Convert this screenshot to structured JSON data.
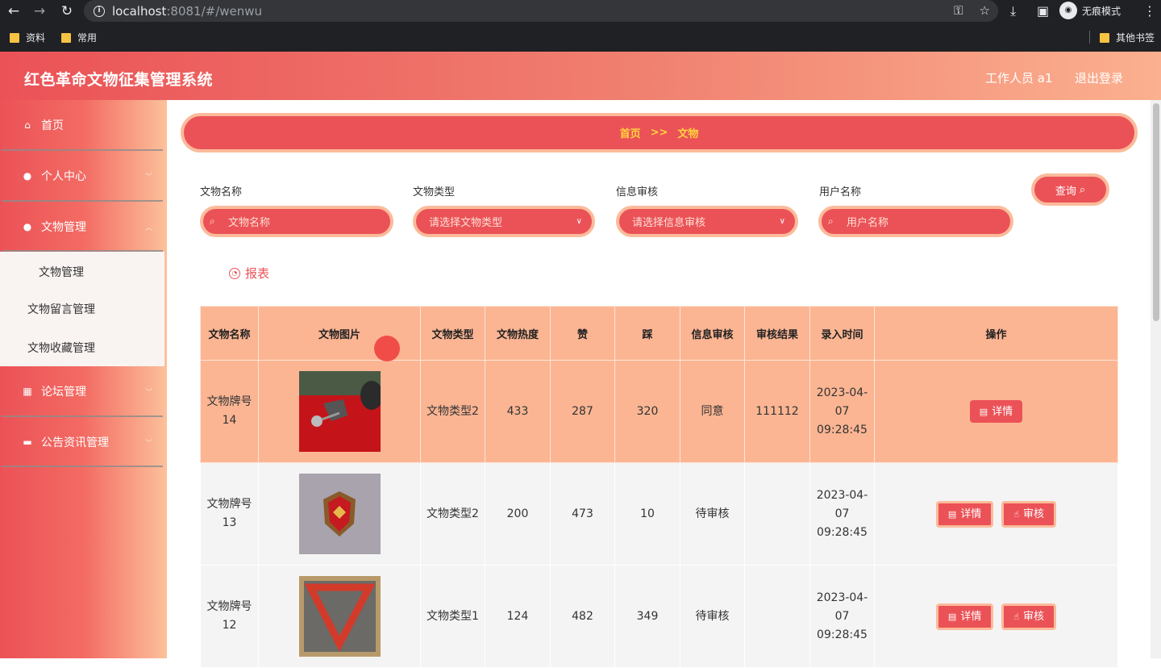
{
  "browser": {
    "url_host": "localhost",
    "url_rest": ":8081/#/wenwu",
    "incognito_label": "无痕模式",
    "bookmarks": [
      "资料",
      "常用"
    ],
    "other_bookmarks": "其他书签"
  },
  "header": {
    "title": "红色革命文物征集管理系统",
    "user": "工作人员 a1",
    "logout": "退出登录"
  },
  "sidebar": {
    "items": [
      {
        "label": "首页",
        "icon": "home-icon"
      },
      {
        "label": "个人中心",
        "icon": "user-icon"
      },
      {
        "label": "文物管理",
        "icon": "user-icon"
      },
      {
        "label": "论坛管理",
        "icon": "grid-icon"
      },
      {
        "label": "公告资讯管理",
        "icon": "briefcase-icon"
      }
    ],
    "submenu": [
      "文物管理",
      "文物留言管理",
      "文物收藏管理"
    ]
  },
  "breadcrumb": {
    "home": "首页",
    "sep": ">>",
    "current": "文物"
  },
  "filters": {
    "name_label": "文物名称",
    "name_placeholder": "文物名称",
    "type_label": "文物类型",
    "type_placeholder": "请选择文物类型",
    "audit_label": "信息审核",
    "audit_placeholder": "请选择信息审核",
    "user_label": "用户名称",
    "user_placeholder": "用户名称",
    "query": "查询"
  },
  "report": "报表",
  "table": {
    "headers": [
      "文物名称",
      "文物图片",
      "文物类型",
      "文物热度",
      "赞",
      "踩",
      "信息审核",
      "审核结果",
      "录入时间",
      "操作"
    ],
    "rows": [
      {
        "name": "文物牌号14",
        "type": "文物类型2",
        "heat": "433",
        "like": "287",
        "dislike": "320",
        "audit": "同意",
        "result": "111112",
        "time": "2023-04-07 09:28:45"
      },
      {
        "name": "文物牌号13",
        "type": "文物类型2",
        "heat": "200",
        "like": "473",
        "dislike": "10",
        "audit": "待审核",
        "result": "",
        "time": "2023-04-07 09:28:45"
      },
      {
        "name": "文物牌号12",
        "type": "文物类型1",
        "heat": "124",
        "like": "482",
        "dislike": "349",
        "audit": "待审核",
        "result": "",
        "time": "2023-04-07 09:28:45"
      }
    ],
    "detail_btn": "详情",
    "audit_btn": "审核"
  }
}
